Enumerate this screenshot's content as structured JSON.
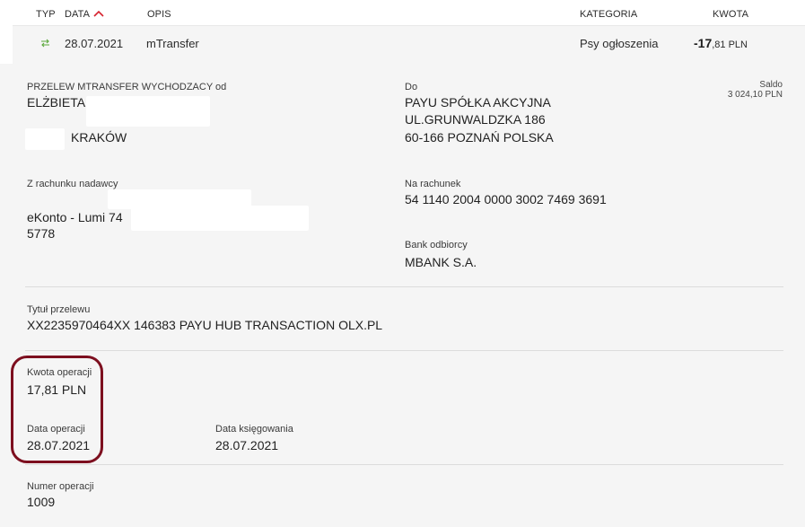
{
  "header": {
    "col_type": "TYP",
    "col_date": "DATA",
    "col_desc": "OPIS",
    "col_category": "KATEGORIA",
    "col_amount": "KWOTA"
  },
  "transaction": {
    "icon": "transfer-arrows-icon",
    "date": "28.07.2021",
    "description": "mTransfer",
    "category": "Psy ogłoszenia",
    "amount_int": "-17",
    "amount_dec": ",81 PLN"
  },
  "details": {
    "sender_label": "PRZELEW MTRANSFER WYCHODZACY od",
    "sender_name": "ELŻBIETA",
    "sender_city": "KRAKÓW",
    "to_label": "Do",
    "recipient_line1": "PAYU SPÓŁKA AKCYJNA",
    "recipient_line2": "UL.GRUNWALDZKA 186",
    "recipient_line3": "60-166 POZNAŃ POLSKA",
    "saldo_label": "Saldo",
    "saldo_value": "3 024,10 PLN",
    "from_account_label": "Z rachunku nadawcy",
    "from_account_line1": "eKonto - Lumi 74",
    "from_account_line2": "5778",
    "to_account_label": "Na rachunek",
    "to_account_number": "54 1140 2004 0000 3002 7469 3691",
    "bank_label": "Bank odbiorcy",
    "bank_name": "MBANK S.A.",
    "title_label": "Tytuł przelewu",
    "title_value": "XX2235970464XX 146383 PAYU HUB TRANSACTION OLX.PL",
    "op_amount_label": "Kwota operacji",
    "op_amount_value": "17,81 PLN",
    "op_date_label": "Data operacji",
    "op_date_value": "28.07.2021",
    "booking_date_label": "Data księgowania",
    "booking_date_value": "28.07.2021",
    "op_number_label": "Numer operacji",
    "op_number_value": "1009"
  },
  "colors": {
    "accent_red": "#d6232f",
    "highlight_circle": "#7d0f1f",
    "transfer_icon": "#5aa83a"
  }
}
